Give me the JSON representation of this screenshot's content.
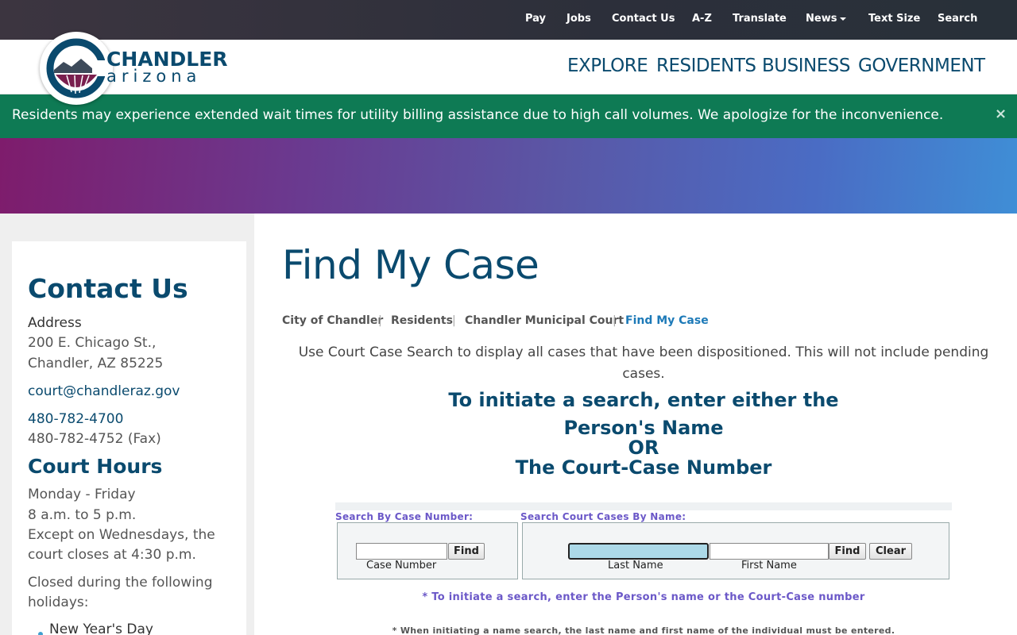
{
  "utility_nav": {
    "items": [
      "Pay",
      "Jobs",
      "Contact Us",
      "A-Z",
      "Translate",
      "News",
      "Text Size",
      "Search"
    ]
  },
  "logo": {
    "line1": "CHANDLER",
    "line2": "arizona"
  },
  "main_nav": {
    "items": [
      "EXPLORE",
      "RESIDENTS",
      "BUSINESS",
      "GOVERNMENT"
    ]
  },
  "alert": {
    "text": "Residents may experience extended wait times for utility billing assistance due to high call volumes. We apologize for the inconvenience.",
    "close": "×"
  },
  "sidebar": {
    "contact_heading": "Contact Us",
    "address_label": "Address",
    "address_line1": "200 E. Chicago St.,",
    "address_line2": "Chandler, AZ 85225",
    "email": "court@chandleraz.gov",
    "phone": "480-782-4700",
    "fax": "480-782-4752 (Fax)",
    "hours_heading": "Court Hours",
    "hours_days": "Monday - Friday",
    "hours_time": "8 a.m. to 5 p.m.",
    "hours_except1": "Except on Wednesdays, the",
    "hours_except2": "court closes at 4:30 p.m.",
    "closed1": "Closed during the following",
    "closed2": "holidays:",
    "holiday1": "New Year's Day"
  },
  "content": {
    "title": "Find My Case",
    "breadcrumb": [
      "City of Chandler",
      "Residents",
      "Chandler Municipal Court",
      "Find My Case"
    ],
    "breadcrumb_sep": "|",
    "intro": "Use Court Case Search to display all cases that have been dispositioned. This will not include pending cases.",
    "instruction_line1": "To initiate a search, enter either the",
    "instruction_line2": "Person's Name",
    "instruction_line3": "OR",
    "instruction_line4": "The Court-Case Number"
  },
  "search_form": {
    "case_legend": "Search By Case Number:",
    "name_legend": "Search Court Cases By Name:",
    "case_number_label": "Case Number",
    "last_name_label": "Last Name",
    "first_name_label": "First Name",
    "find_label": "Find",
    "clear_label": "Clear",
    "case_number_value": "",
    "last_name_value": "",
    "first_name_value": "",
    "note1": "* To initiate a search, enter the Person's name or the Court-Case number",
    "note2": "* When initiating a name search, the last name and first name of the individual must be entered."
  },
  "colors": {
    "brand_blue": "#0a4a6e",
    "alert_green": "#0e7a54",
    "link_blue": "#1d7ab8",
    "form_purple": "#6b58c8",
    "highlight_field": "#acd9e8"
  }
}
